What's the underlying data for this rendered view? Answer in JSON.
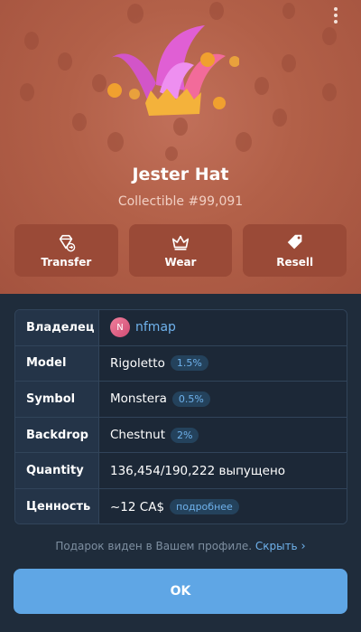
{
  "gift": {
    "title": "Jester Hat",
    "subtitle": "Collectible #99,091"
  },
  "actions": [
    {
      "label": "Transfer",
      "icon": "gem-transfer-icon"
    },
    {
      "label": "Wear",
      "icon": "crown-icon"
    },
    {
      "label": "Resell",
      "icon": "price-tag-icon"
    }
  ],
  "details": {
    "owner": {
      "label": "Владелец",
      "avatar_letter": "N",
      "name": "nfmap"
    },
    "model": {
      "label": "Model",
      "value": "Rigoletto",
      "badge": "1.5%"
    },
    "symbol": {
      "label": "Symbol",
      "value": "Monstera",
      "badge": "0.5%"
    },
    "backdrop": {
      "label": "Backdrop",
      "value": "Chestnut",
      "badge": "2%"
    },
    "quantity": {
      "label": "Quantity",
      "value": "136,454/190,222 выпущено"
    },
    "value": {
      "label": "Ценность",
      "value": "~12 CA$",
      "badge": "подробнее"
    }
  },
  "notice": {
    "text": "Подарок виден в Вашем профиле.",
    "link": "Скрыть"
  },
  "ok_label": "OK",
  "colors": {
    "backdrop": "#b26048",
    "sheet": "#1f2c3b",
    "accent": "#5fa6e5"
  }
}
